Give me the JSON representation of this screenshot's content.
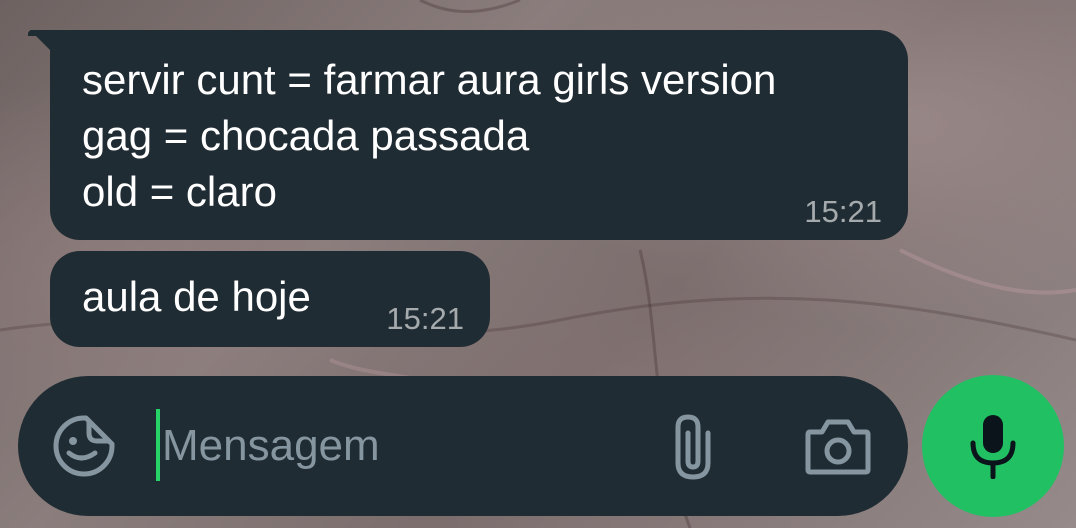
{
  "messages": [
    {
      "lines": [
        "servir cunt = farmar aura girls version",
        "gag = chocada passada",
        "old = claro"
      ],
      "time": "15:21"
    },
    {
      "lines": [
        "aula de hoje"
      ],
      "time": "15:21"
    }
  ],
  "composer": {
    "placeholder": "Mensagem",
    "value": "",
    "icons": {
      "emoji": "sticker-icon",
      "attach": "paperclip-icon",
      "camera": "camera-icon",
      "mic": "microphone-icon"
    }
  },
  "colors": {
    "bubble": "#202c33",
    "accent": "#21c063",
    "icon_gray": "#8696a0"
  }
}
